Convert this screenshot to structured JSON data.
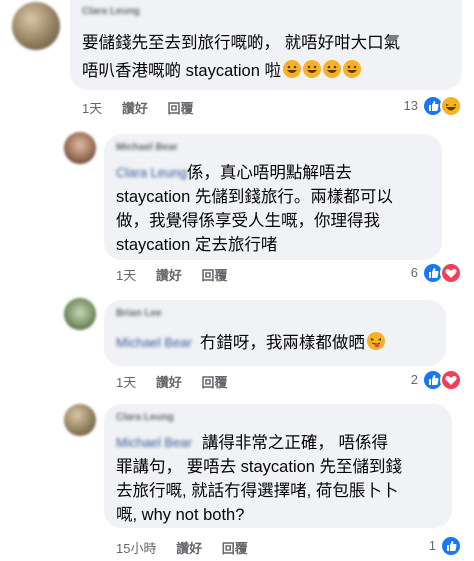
{
  "comments": [
    {
      "author": "Clara Leung",
      "lines": [
        "要儲錢先至去到旅行嘅啲， 就唔好咁大口氣",
        "唔叭香港嘅啲 staycation 啦"
      ],
      "emoji": [
        "rofl-emoji",
        "rofl-emoji",
        "rofl-emoji",
        "rofl-emoji"
      ],
      "time": "1天",
      "like_label": "讚好",
      "reply_label": "回覆",
      "reaction_count": "13",
      "reactions": [
        "like-icon",
        "haha-icon"
      ]
    },
    {
      "author": "Michael Bear",
      "mention": "Clara Leung",
      "lines": [
        "係，真心唔明點解唔去",
        "staycation 先儲到錢旅行。兩樣都可以",
        "做，我覺得係享受人生嘅，你理得我",
        "staycation 定去旅行啫"
      ],
      "time": "1天",
      "like_label": "讚好",
      "reply_label": "回覆",
      "reaction_count": "6",
      "reactions": [
        "like-icon",
        "love-icon"
      ]
    },
    {
      "author": "Brian Lee",
      "mention": "Michael Bear",
      "lines": [
        "冇錯呀，我兩樣都做晒"
      ],
      "emoji": [
        "tongue-emoji"
      ],
      "time": "1天",
      "like_label": "讚好",
      "reply_label": "回覆",
      "reaction_count": "2",
      "reactions": [
        "like-icon",
        "love-icon"
      ]
    },
    {
      "author": "Clara Leung",
      "mention": "Michael Bear",
      "lines": [
        "講得非常之正確， 唔係得",
        "罪講句， 要唔去 staycation 先至儲到錢",
        "去旅行嘅, 就話冇得選擇啫, 荷包脹卜卜",
        "嘅, why not both?"
      ],
      "time": "15小時",
      "like_label": "讚好",
      "reply_label": "回覆",
      "reaction_count": "1",
      "reactions": [
        "like-icon"
      ]
    }
  ],
  "colors": {
    "bubble": "#f0f2f5",
    "meta": "#65676b",
    "like": "#1877f2",
    "love": "#f33e58",
    "haha": "#f7b125",
    "mention": "#385898"
  }
}
